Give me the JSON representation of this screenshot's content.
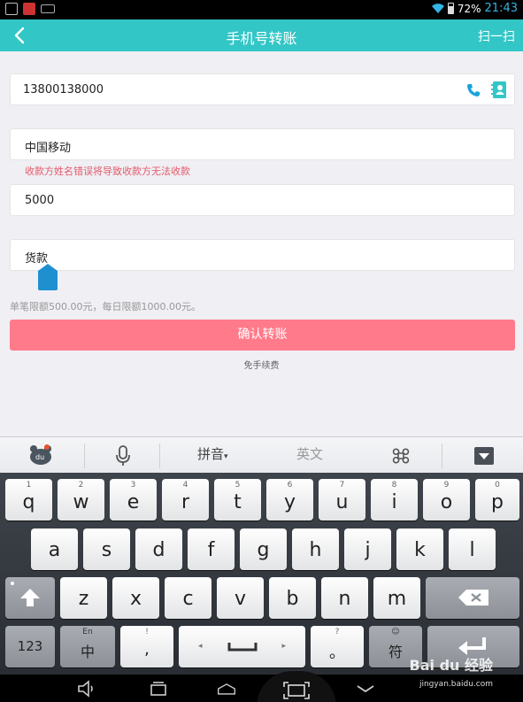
{
  "status_bar": {
    "battery": "72%",
    "time": "21:43"
  },
  "header": {
    "title": "手机号转账",
    "scan_label": "扫一扫"
  },
  "form": {
    "phone_value": "13800138000",
    "name_value": "中国移动",
    "warning": "收款方姓名错误将导致收款方无法收款",
    "amount_value": "5000",
    "note_value": "货款",
    "limit_text": "单笔限额500.00元，每日限额1000.00元。",
    "confirm_label": "确认转账",
    "fee_text": "免手续费"
  },
  "ime_bar": {
    "pinyin_label": "拼音",
    "english_label": "英文"
  },
  "keyboard": {
    "row1": [
      {
        "sub": "1",
        "main": "q"
      },
      {
        "sub": "2",
        "main": "w"
      },
      {
        "sub": "3",
        "main": "e"
      },
      {
        "sub": "4",
        "main": "r"
      },
      {
        "sub": "5",
        "main": "t"
      },
      {
        "sub": "6",
        "main": "y"
      },
      {
        "sub": "7",
        "main": "u"
      },
      {
        "sub": "8",
        "main": "i"
      },
      {
        "sub": "9",
        "main": "o"
      },
      {
        "sub": "0",
        "main": "p"
      }
    ],
    "row2": [
      "a",
      "s",
      "d",
      "f",
      "g",
      "h",
      "j",
      "k",
      "l"
    ],
    "row3": [
      "z",
      "x",
      "c",
      "v",
      "b",
      "n",
      "m"
    ],
    "num_label": "123",
    "lang_sub": "En",
    "lang_main": "中",
    "comma_sub": "!",
    "comma_main": ",",
    "period_sub": "?",
    "period_main": "。",
    "symbol_label": "符"
  },
  "watermark": {
    "main": "Bai du 经验",
    "sub": "jingyan.baidu.com"
  }
}
